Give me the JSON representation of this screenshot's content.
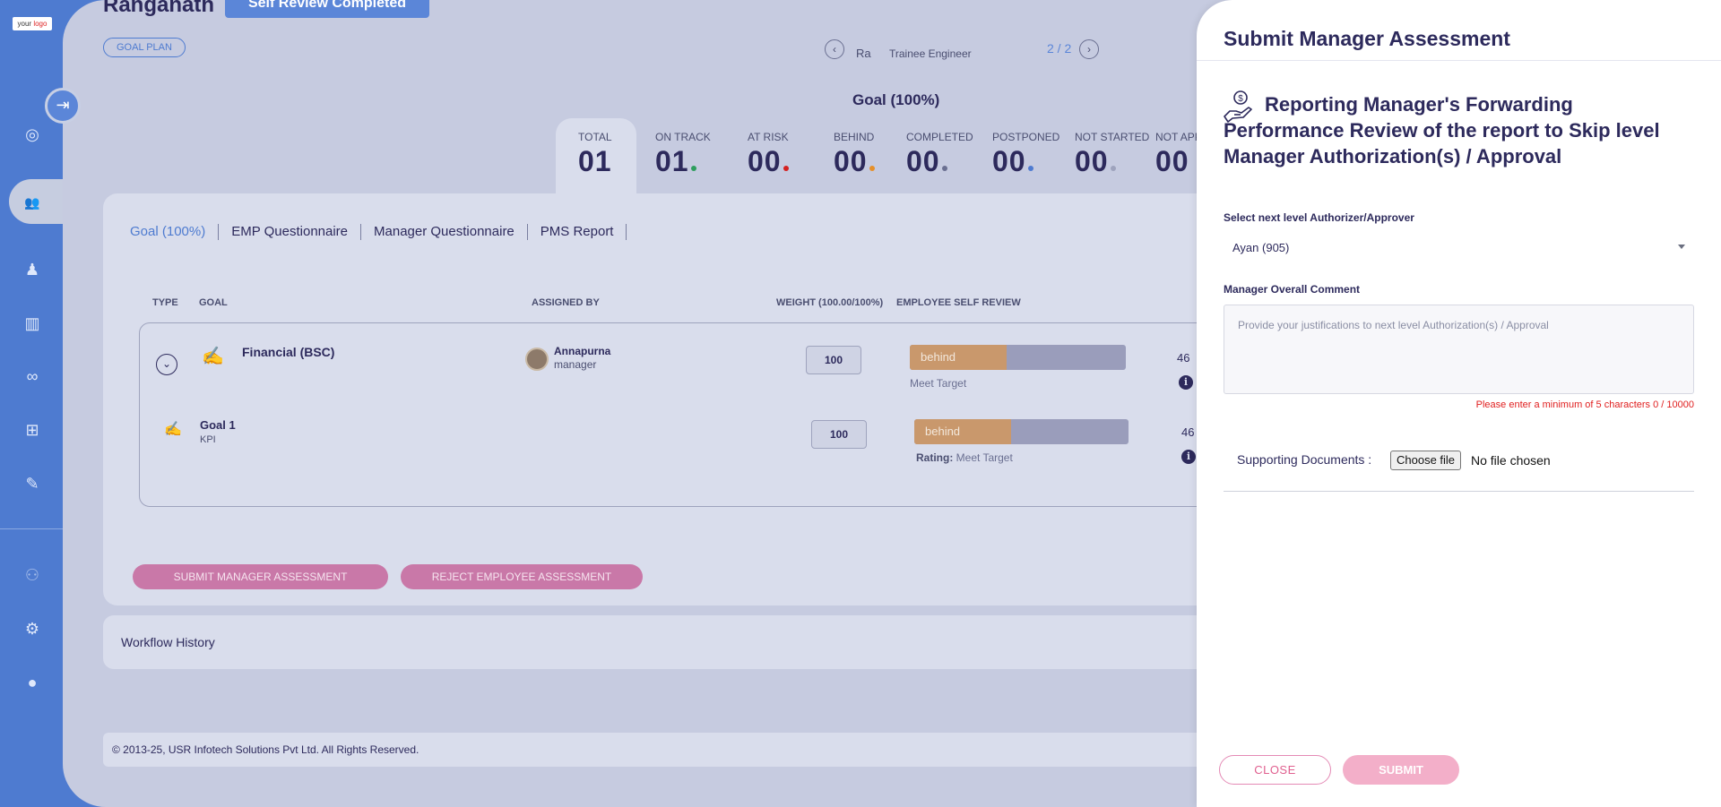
{
  "brand": {
    "logo_text_1": "your",
    "logo_text_2": "logo"
  },
  "sidebar": {
    "toggle_glyph": "⇥",
    "items": [
      {
        "icon": "target-icon",
        "glyph": "◎"
      },
      {
        "icon": "team-icon",
        "glyph": "👥"
      },
      {
        "icon": "person-icon",
        "glyph": "♟"
      },
      {
        "icon": "book-icon",
        "glyph": "▥"
      },
      {
        "icon": "handshake-icon",
        "glyph": "∞"
      },
      {
        "icon": "hierarchy-icon",
        "glyph": "⊞"
      },
      {
        "icon": "form-icon",
        "glyph": "✎"
      },
      {
        "icon": "group-icon",
        "glyph": "⚇"
      },
      {
        "icon": "gear-icon",
        "glyph": "⚙"
      },
      {
        "icon": "user-icon",
        "glyph": "●"
      }
    ]
  },
  "header": {
    "employee_name": "Ranganath",
    "status_button": "Self Review Completed",
    "goal_plan_button": "GOAL PLAN",
    "designation_short": "Ra",
    "designation": "Trainee Engineer",
    "pager": "2 / 2",
    "prev_glyph": "‹",
    "next_glyph": "›"
  },
  "goal_heading": "Goal (100%)",
  "stats": [
    {
      "label": "TOTAL",
      "value": "01",
      "dot": ""
    },
    {
      "label": "ON TRACK",
      "value": "01",
      "dot": "#2e9e5e"
    },
    {
      "label": "AT RISK",
      "value": "00",
      "dot": "#d42020"
    },
    {
      "label": "BEHIND",
      "value": "00",
      "dot": "#e6902a"
    },
    {
      "label": "COMPLETED",
      "value": "00",
      "dot": "#6a6f91"
    },
    {
      "label": "POSTPONED",
      "value": "00",
      "dot": "#4e7bd0"
    },
    {
      "label": "NOT STARTED",
      "value": "00",
      "dot": "#9ea3bd"
    },
    {
      "label": "NOT APP",
      "value": "00",
      "dot": ""
    }
  ],
  "tabs": [
    "Goal (100%)",
    "EMP Questionnaire",
    "Manager Questionnaire",
    "PMS Report"
  ],
  "table": {
    "headers": [
      "TYPE",
      "GOAL",
      "ASSIGNED BY",
      "WEIGHT (100.00/100%)",
      "EMPLOYEE SELF REVIEW"
    ],
    "rows": [
      {
        "name": "Financial (BSC)",
        "sub": "",
        "assignee": "Annapurna",
        "assignee_role": "manager",
        "weight": "100",
        "status": "behind",
        "progress": 0.45,
        "rating_label": "",
        "rating": "Meet Target",
        "score": "46"
      },
      {
        "name": "Goal 1",
        "sub": "KPI",
        "assignee": "",
        "assignee_role": "",
        "weight": "100",
        "status": "behind",
        "progress": 0.45,
        "rating_label": "Rating:",
        "rating": "Meet Target",
        "score": "46"
      }
    ]
  },
  "actions": {
    "submit_manager": "SUBMIT MANAGER ASSESSMENT",
    "reject_employee": "REJECT EMPLOYEE ASSESSMENT"
  },
  "workflow_label": "Workflow History",
  "footer": "© 2013-25, USR Infotech Solutions Pvt Ltd. All Rights Reserved.",
  "drawer": {
    "title": "Submit Manager Assessment",
    "heading": "Reporting Manager's Forwarding Performance Review of the report to Skip level Manager Authorization(s) / Approval",
    "approver_label": "Select next level Authorizer/Approver",
    "approver_value": "Ayan (905)",
    "comment_label": "Manager Overall Comment",
    "comment_placeholder": "Provide your justifications to next level Authorization(s) / Approval",
    "error": "Please enter a minimum of 5 characters 0 / 10000",
    "supporting_label": "Supporting Documents :",
    "file_button": "Choose file",
    "file_status": "No file chosen",
    "close_label": "CLOSE",
    "submit_label": "SUBMIT"
  },
  "colors": {
    "accent": "#4e7bd0",
    "dark": "#2d2a5c",
    "pink": "#e0608f",
    "error": "#e02020"
  }
}
